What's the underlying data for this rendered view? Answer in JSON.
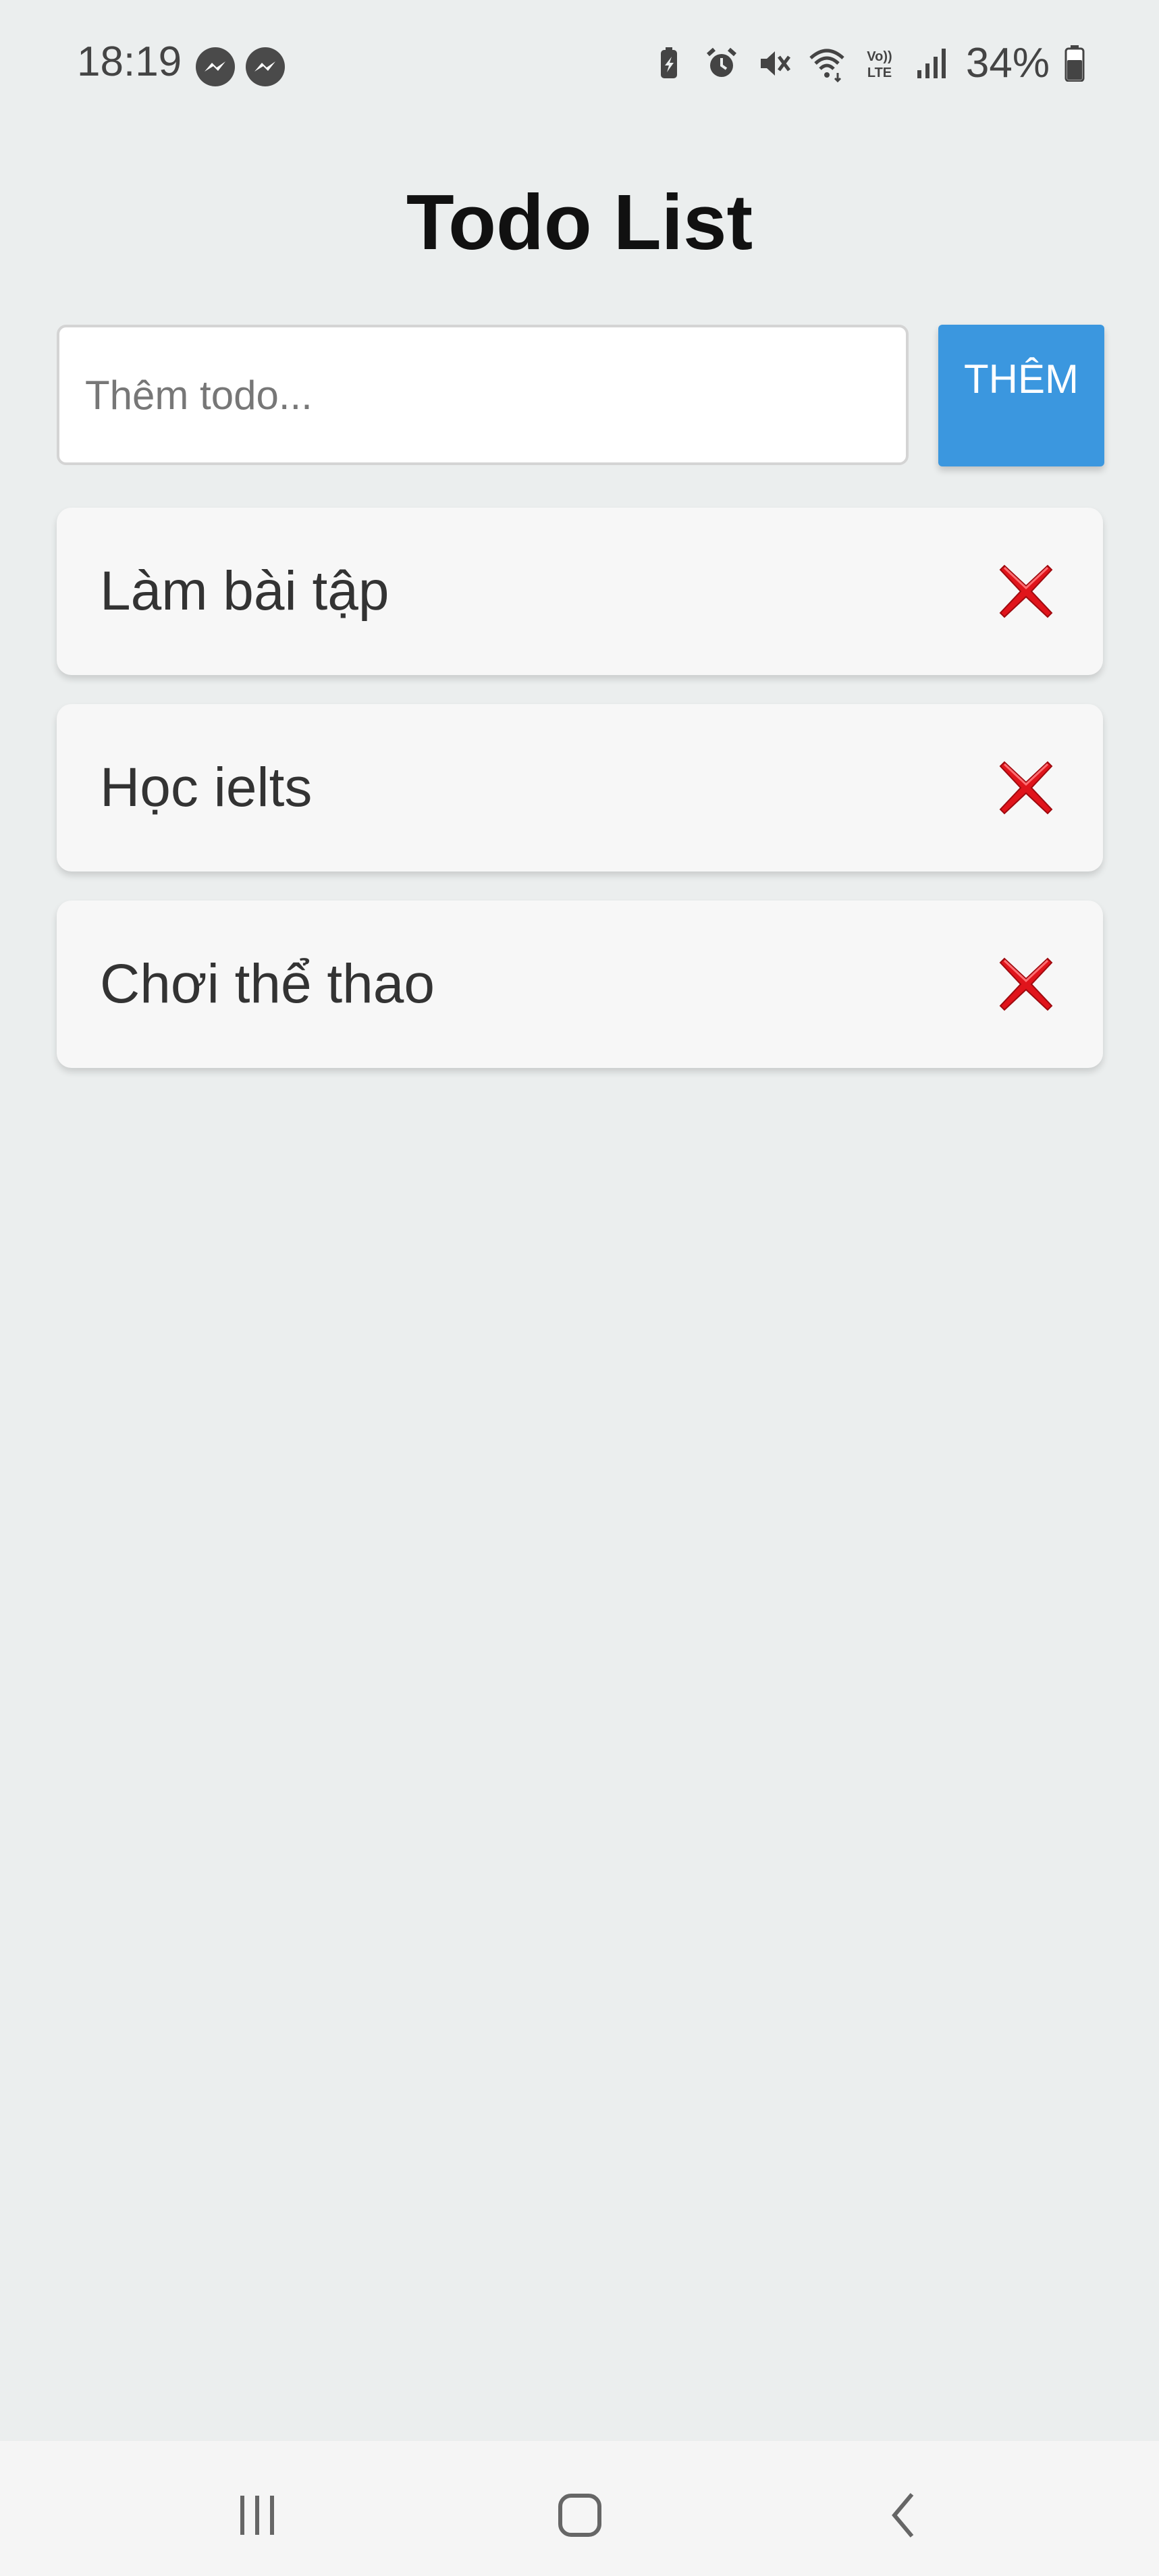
{
  "status_bar": {
    "time": "18:19",
    "left_icons": [
      "messenger-icon",
      "messenger-icon"
    ],
    "right_icons": [
      "battery-saver-icon",
      "alarm-icon",
      "mute-icon",
      "wifi-icon",
      "volte-icon",
      "signal-icon"
    ],
    "volte_label": "VoLTE",
    "battery_percent": "34%"
  },
  "app": {
    "title": "Todo List",
    "input": {
      "placeholder": "Thêm todo...",
      "value": ""
    },
    "add_button_label": "THÊM",
    "todos": [
      {
        "text": "Làm bài tập",
        "delete_icon": "red-x-icon"
      },
      {
        "text": "Học ielts",
        "delete_icon": "red-x-icon"
      },
      {
        "text": "Chơi thể thao",
        "delete_icon": "red-x-icon"
      }
    ]
  },
  "nav_bar": {
    "items": [
      "recent-apps-icon",
      "home-icon",
      "back-icon"
    ]
  },
  "colors": {
    "background": "#ebeeee",
    "accent_button": "#3b97df",
    "card": "#f7f7f7",
    "delete_red": "#e0141b"
  }
}
